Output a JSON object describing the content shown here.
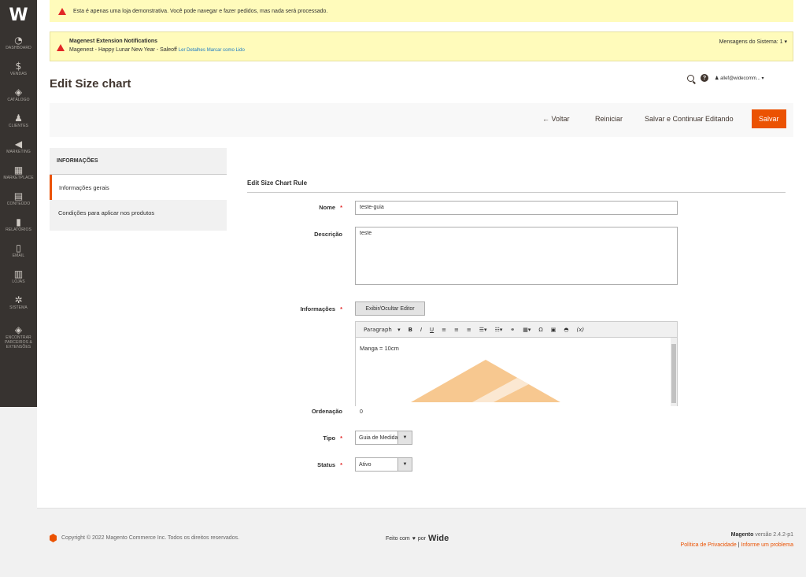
{
  "logo": "W",
  "nav": [
    {
      "label": "DASHBOARD",
      "icon": "dashboard-icon",
      "glyph": "◔"
    },
    {
      "label": "VENDAS",
      "icon": "dollar-icon",
      "glyph": "$"
    },
    {
      "label": "CATÁLOGO",
      "icon": "cube-icon",
      "glyph": "◈"
    },
    {
      "label": "CLIENTES",
      "icon": "person-icon",
      "glyph": "♟"
    },
    {
      "label": "MARKETING",
      "icon": "megaphone-icon",
      "glyph": "◀"
    },
    {
      "label": "MARKETPLACE",
      "icon": "store-icon",
      "glyph": "▦"
    },
    {
      "label": "CONTEÚDO",
      "icon": "content-icon",
      "glyph": "▤"
    },
    {
      "label": "RELATÓRIOS",
      "icon": "bar-chart-icon",
      "glyph": "▮"
    },
    {
      "label": "EMAIL",
      "icon": "file-icon",
      "glyph": "▯"
    },
    {
      "label": "LOJAS",
      "icon": "shop-icon",
      "glyph": "▥"
    },
    {
      "label": "SISTEMA",
      "icon": "gear-icon",
      "glyph": "✲"
    },
    {
      "label": "ENCONTRAR PARCEIROS & EXTENSÕES",
      "icon": "partners-icon",
      "glyph": "◈"
    }
  ],
  "demo_notice": "Esta é apenas uma loja demonstrativa. Você pode navegar e fazer pedidos, mas nada será processado.",
  "notification": {
    "title": "Magenest Extension Notifications",
    "text": "Magenest - Happy Lunar New Year - Saleoff",
    "read_link": "Ler Detalhes",
    "mark_link": "Marcar como Lido",
    "system_messages": "Mensagens do Sistema: 1"
  },
  "page_title": "Edit Size chart",
  "user": "allef@widecomm...",
  "toolbar": {
    "back": "Voltar",
    "reset": "Reiniciar",
    "save_continue": "Salvar e Continuar Editando",
    "save": "Salvar"
  },
  "tabs": {
    "header": "INFORMAÇÕES",
    "items": [
      "Informações gerais",
      "Condições para aplicar nos produtos"
    ]
  },
  "section_title": "Edit Size Chart Rule",
  "form": {
    "name_label": "Nome",
    "name_value": "teste-guia",
    "desc_label": "Descrição",
    "desc_value": "teste",
    "info_label": "Informações",
    "toggle_editor": "Exibir/Ocultar Editor",
    "editor_format": "Paragraph",
    "editor_content": "Manga = 10cm",
    "order_label": "Ordenação",
    "order_value": "0",
    "type_label": "Tipo",
    "type_value": "Guia de Medidas",
    "status_label": "Status",
    "status_value": "Ativo"
  },
  "footer": {
    "copyright": "Copyright © 2022 Magento Commerce Inc. Todos os direitos reservados.",
    "made_with": "Feito com",
    "by": "por",
    "brand": "Wide",
    "magento": "Magento",
    "version": "versão 2.4.2-p1",
    "privacy": "Política de Privacidade",
    "report": "Informe um problema"
  }
}
